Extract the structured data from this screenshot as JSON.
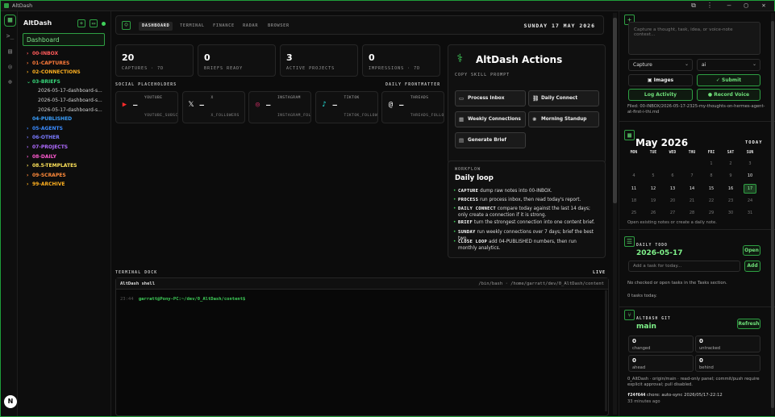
{
  "window": {
    "title": "AltDash"
  },
  "sidebar": {
    "brand": "AltDash",
    "search_value": "Dashboard",
    "items": [
      {
        "label": "00-INBOX",
        "color": "#ff5a5a"
      },
      {
        "label": "01-CAPTURES",
        "color": "#ff7b3a"
      },
      {
        "label": "02-CONNECTIONS",
        "color": "#ffb020"
      },
      {
        "label": "03-BRIEFS",
        "color": "#37d67a",
        "open": true
      },
      {
        "label": "04-PUBLISHED",
        "color": "#3aa0ff"
      },
      {
        "label": "05-AGENTS",
        "color": "#3a8bff"
      },
      {
        "label": "06-OTHER",
        "color": "#7a7aff"
      },
      {
        "label": "07-PROJECTS",
        "color": "#b06bff"
      },
      {
        "label": "08-DAILY",
        "color": "#ff5ad0"
      },
      {
        "label": "08.5-TEMPLATES",
        "color": "#ffe35a"
      },
      {
        "label": "09-SCRAPES",
        "color": "#ff8a3a"
      },
      {
        "label": "99-ARCHIVE",
        "color": "#ffb020"
      }
    ],
    "files": [
      "2026-05-17-dashboard-s...",
      "2026-05-17-dashboard-s...",
      "2026-05-17-dashboard-s..."
    ],
    "rail_badge": "N"
  },
  "topnav": {
    "tabs": [
      "DASHBOARD",
      "TERMINAL",
      "FINANCE",
      "RADAR",
      "BROWSER"
    ],
    "date": "SUNDAY 17 MAY 2026"
  },
  "stats": [
    {
      "value": "20",
      "label": "CAPTURES · 7D"
    },
    {
      "value": "0",
      "label": "BRIEFS READY"
    },
    {
      "value": "3",
      "label": "ACTIVE PROJECTS"
    },
    {
      "value": "0",
      "label": "IMPRESSIONS · 7D"
    }
  ],
  "social": {
    "header": "SOCIAL PLACEHOLDERS",
    "frontmatter": "DAILY FRONTMATTER",
    "cards": [
      {
        "name": "YOUTUBE",
        "value": "—",
        "key": "YOUTUBE_SUBSCR...",
        "icon": "youtube-icon",
        "color": "#ff2b2b",
        "glyph": "▶"
      },
      {
        "name": "X",
        "value": "—",
        "key": "X_FOLLOWERS",
        "icon": "x-icon",
        "color": "#ffffff",
        "glyph": "𝕏"
      },
      {
        "name": "INSTAGRAM",
        "value": "—",
        "key": "INSTAGRAM_FOLL...",
        "icon": "instagram-icon",
        "color": "#e1306c",
        "glyph": "◎"
      },
      {
        "name": "TIKTOK",
        "value": "—",
        "key": "TIKTOK_FOLLOWE...",
        "icon": "tiktok-icon",
        "color": "#25f4ee",
        "glyph": "♪"
      },
      {
        "name": "THREADS",
        "value": "—",
        "key": "THREADS_FOLLOW...",
        "icon": "threads-icon",
        "color": "#ffffff",
        "glyph": "@"
      }
    ]
  },
  "actions": {
    "title": "AltDash Actions",
    "sub": "COPY SKILL PROMPT",
    "buttons": [
      "Process Inbox",
      "Daily Connect",
      "Weekly Connections",
      "Morning Standup",
      "Generate Brief"
    ]
  },
  "workflow": {
    "kicker": "WORKFLOW",
    "title": "Daily loop",
    "steps": [
      {
        "k": "CAPTURE",
        "t": "dump raw notes into 00-INBOX."
      },
      {
        "k": "PROCESS",
        "t": "run process inbox, then read today's report."
      },
      {
        "k": "DAILY CONNECT",
        "t": "compare today against the last 14 days; only create a connection if it is strong."
      },
      {
        "k": "BRIEF",
        "t": "turn the strongest connection into one content brief."
      },
      {
        "k": "SUNDAY",
        "t": "run weekly connections over 7 days; brief the best two."
      },
      {
        "k": "CLOSE LOOP",
        "t": "add 04-PUBLISHED numbers, then run monthly analytics."
      }
    ]
  },
  "terminal": {
    "header": "TERMINAL DOCK",
    "live": "LIVE",
    "name": "AltDash shell",
    "path": "/bin/bash · /home/garratt/dev/0_AltDash/content",
    "time": "23:44",
    "prompt": "garratt@Pony-PC:~/dev/0_AltDash/content$"
  },
  "capture": {
    "placeholder": "Capture a thought, task, idea, or voice-note context...",
    "type": "Capture",
    "agent": "ai",
    "images": "Images",
    "submit": "Submit",
    "log": "Log Activity",
    "record": "Record Voice",
    "filed": "Filed: 00-INBOX/2026-05-17-2325-my-thoughts-on-hermes-agent-at-first-i-thi.md"
  },
  "calendar": {
    "month": "May 2026",
    "today_label": "TODAY",
    "weekdays": [
      "MON",
      "TUE",
      "WED",
      "THU",
      "FRI",
      "SAT",
      "SUN"
    ],
    "weeks": [
      [
        "",
        "",
        "",
        "",
        "1",
        "2",
        "3"
      ],
      [
        "4",
        "5",
        "6",
        "7",
        "8",
        "9",
        "10"
      ],
      [
        "11",
        "12",
        "13",
        "14",
        "15",
        "16",
        "17"
      ],
      [
        "18",
        "19",
        "20",
        "21",
        "22",
        "23",
        "24"
      ],
      [
        "25",
        "26",
        "27",
        "28",
        "29",
        "30",
        "31"
      ]
    ],
    "highlight": [
      "10",
      "11",
      "12",
      "13",
      "14",
      "15",
      "16"
    ],
    "today": "17",
    "hint": "Open existing notes or create a daily note."
  },
  "todo": {
    "kicker": "DAILY TODO",
    "date": "2026-05-17",
    "open": "Open",
    "input_placeholder": "Add a task for today...",
    "add": "Add",
    "empty": "No checked or open tasks in the Tasks section.",
    "count": "0 tasks today."
  },
  "git": {
    "kicker": "ALTDASH GIT",
    "branch": "main",
    "refresh": "Refresh",
    "stats": [
      {
        "v": "0",
        "l": "changed"
      },
      {
        "v": "0",
        "l": "untracked"
      },
      {
        "v": "0",
        "l": "ahead"
      },
      {
        "v": "0",
        "l": "behind"
      }
    ],
    "note": "0_AltDash · origin/main · read-only panel; commit/push require explicit approval; pull disabled.",
    "commit": "f24f644",
    "commit_msg": "chore: auto-sync 2026/05/17-22:12",
    "ago": "33 minutes ago"
  }
}
